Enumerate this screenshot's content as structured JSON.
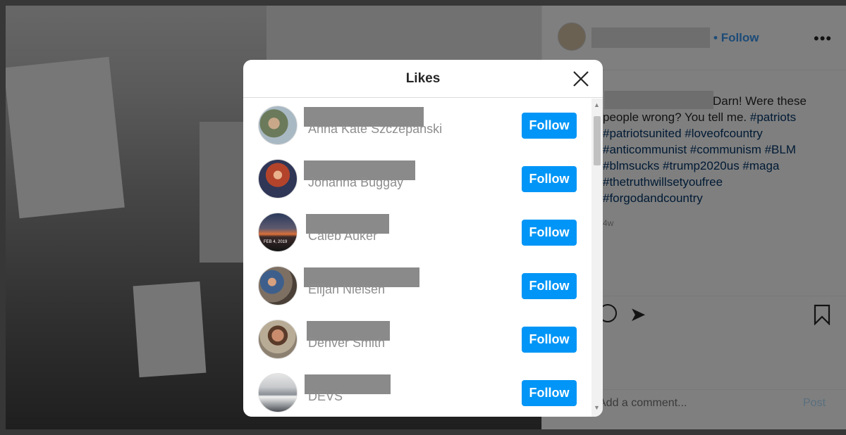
{
  "post": {
    "follow_label": "Follow",
    "more_icon": "more-horizontal-icon",
    "caption_lead": "Darn! Were these people wrong? You tell me.",
    "caption_tags": "#patriots #patriotsunited #loveofcountry #anticommunist #communism #BLM #blmsucks #trump2020us #maga #thetruthwillsetyoufree #forgodandcountry",
    "time_ago": "4w",
    "comment_placeholder": "Add a comment...",
    "post_label": "Post",
    "colors": {
      "link_blue": "#3897f0",
      "post_disabled": "#b2dffc"
    }
  },
  "modal": {
    "title": "Likes",
    "close_icon": "close-icon",
    "follow_label": "Follow",
    "users": [
      {
        "full_name": "Anna Kate Szczepanski"
      },
      {
        "full_name": "Johanna Buggay"
      },
      {
        "full_name": "Caleb Auker",
        "avatar_text": "FEB 4, 2019"
      },
      {
        "full_name": "Elijah Nielsen"
      },
      {
        "full_name": "Denver Smith"
      },
      {
        "full_name": "DEVS"
      }
    ],
    "colors": {
      "follow_button": "#0095f6",
      "secondary_text": "#8e8e8e"
    }
  }
}
